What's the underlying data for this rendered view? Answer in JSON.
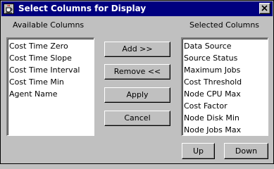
{
  "window": {
    "title": "Select Columns for Display"
  },
  "available": {
    "header": "Available Columns",
    "items": [
      {
        "label": "Cost Time Zero"
      },
      {
        "label": "Cost Time Slope"
      },
      {
        "label": "Cost Time Interval"
      },
      {
        "label": "Cost Time Min"
      },
      {
        "label": "Agent Name"
      }
    ]
  },
  "selected": {
    "header": "Selected Columns",
    "items": [
      {
        "label": "Data Source"
      },
      {
        "label": "Source Status"
      },
      {
        "label": "Maximum Jobs"
      },
      {
        "label": "Cost Threshold"
      },
      {
        "label": "Node CPU Max"
      },
      {
        "label": "Cost Factor"
      },
      {
        "label": "Node Disk Min"
      },
      {
        "label": "Node Jobs Max"
      }
    ]
  },
  "actions": {
    "add": "Add >>",
    "remove": "Remove <<",
    "apply": "Apply",
    "cancel": "Cancel",
    "up": "Up",
    "down": "Down"
  },
  "icons": {
    "app": "java-cup-icon",
    "close": "close-icon"
  },
  "colors": {
    "titlebar": "#00007f",
    "face": "#c0c0c0",
    "list_bg": "#ffffff"
  }
}
